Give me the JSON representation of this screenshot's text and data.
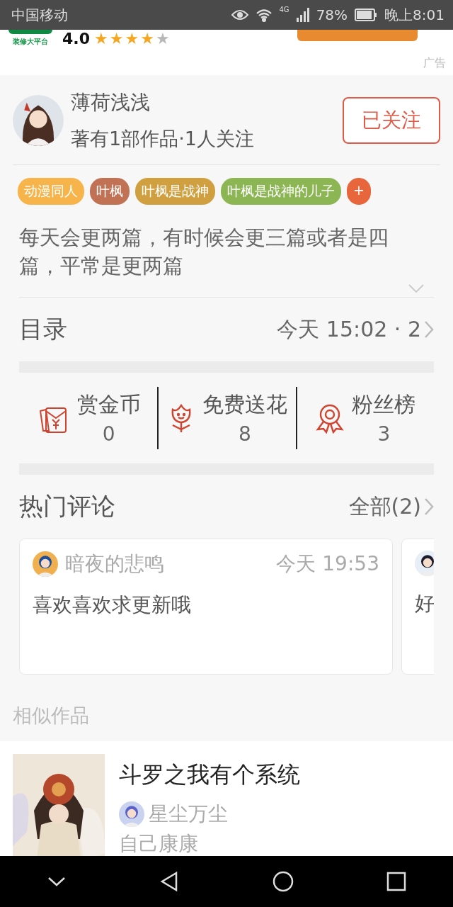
{
  "status_bar": {
    "carrier": "中国移动",
    "network": "4G",
    "battery": "78%",
    "time": "晚上8:01"
  },
  "ad": {
    "logo_caption": "装修大平台",
    "rating": "4.0",
    "stars": 4,
    "ad_label": "广告"
  },
  "author": {
    "name": "薄荷浅浅",
    "info": "著有1部作品·1人关注",
    "follow_button": "已关注",
    "followed": true
  },
  "tags": [
    {
      "label": "动漫同人",
      "color": "#f7b44a"
    },
    {
      "label": "叶枫",
      "color": "#c27254"
    },
    {
      "label": "叶枫是战神",
      "color": "#d0a040"
    },
    {
      "label": "叶枫是战神的儿子",
      "color": "#8cb653"
    },
    {
      "label": "+",
      "color": "#e8663c"
    }
  ],
  "description": "每天会更两篇，有时候会更三篇或者是四篇，平常是更两篇",
  "catalog": {
    "title": "目录",
    "update": "今天 15:02 · 2"
  },
  "stats": [
    {
      "kind": "coin",
      "label": "赏金币",
      "value": "0"
    },
    {
      "kind": "flower",
      "label": "免费送花",
      "value": "8"
    },
    {
      "kind": "fans",
      "label": "粉丝榜",
      "value": "3"
    }
  ],
  "comments": {
    "title": "热门评论",
    "all_link": "全部(2)",
    "items": [
      {
        "user": "暗夜的悲鸣",
        "time": "今天 19:53",
        "text": "喜欢喜欢求更新哦"
      },
      {
        "text": "好"
      }
    ]
  },
  "similar": {
    "title": "相似作品",
    "items": [
      {
        "title": "斗罗之我有个系统",
        "author": "星尘万尘",
        "summary": "自己康康"
      }
    ]
  }
}
